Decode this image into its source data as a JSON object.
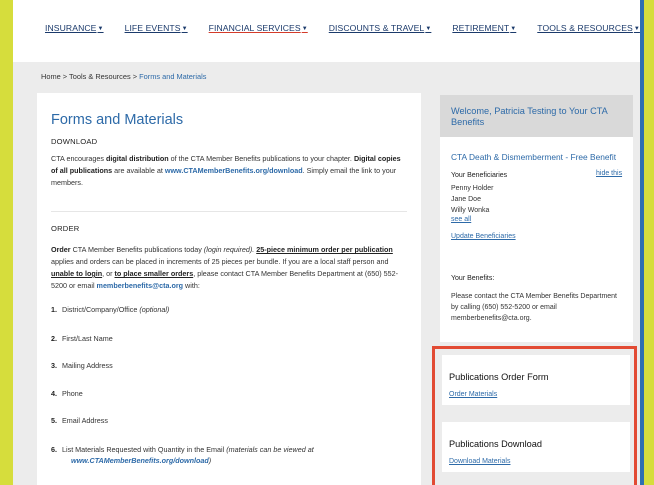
{
  "nav": [
    {
      "label": "INSURANCE",
      "red": false
    },
    {
      "label": "LIFE EVENTS",
      "red": false
    },
    {
      "label": "FINANCIAL SERVICES",
      "red": true
    },
    {
      "label": "DISCOUNTS & TRAVEL",
      "red": false
    },
    {
      "label": "RETIREMENT",
      "red": false
    },
    {
      "label": "TOOLS & RESOURCES",
      "red": false
    }
  ],
  "breadcrumb": {
    "home": "Home",
    "sep": ">",
    "section": "Tools & Resources",
    "current": "Forms and Materials"
  },
  "main": {
    "title": "Forms and Materials",
    "download_label": "DOWNLOAD",
    "download_p": {
      "t1": "CTA encourages ",
      "b1": "digital distribution",
      "t2": " of the CTA Member Benefits publications to your chapter. ",
      "b2": "Digital copies of all publications",
      "t3": " are available at ",
      "link": "www.CTAMemberBenefits.org/download",
      "t4": ". Simply email the link to your members."
    },
    "order_label": "ORDER",
    "order_p": {
      "b1": "Order",
      "t1": " CTA Member Benefits publications today ",
      "i1": "(login required).",
      "t2": " ",
      "u1": "25-piece minimum order per publication",
      "t3": " applies and orders can be placed in increments of 25 pieces per bundle. If you are a local staff person and ",
      "u2": "unable to login",
      "t4": ", or ",
      "u3": "to place smaller orders",
      "t5": ", please contact CTA Member Benefits Department at (650) 552-5200 or email ",
      "email": "memberbenefits@cta.org",
      "t6": " with:"
    },
    "list": [
      {
        "n": "1.",
        "text": "District/Company/Office ",
        "note": "(optional)"
      },
      {
        "n": "2.",
        "text": "First/Last Name",
        "note": ""
      },
      {
        "n": "3.",
        "text": "Mailing Address",
        "note": ""
      },
      {
        "n": "4.",
        "text": "Phone",
        "note": ""
      },
      {
        "n": "5.",
        "text": "Email Address",
        "note": ""
      },
      {
        "n": "6.",
        "text": "List Materials Requested with Quantity in the Email ",
        "note": "(materials can be viewed at ",
        "link": "www.CTAMemberBenefits.org/download",
        "close": ")"
      }
    ]
  },
  "sidebar": {
    "welcome": "Welcome, Patricia Testing to Your CTA Benefits",
    "benefit_title": "CTA Death & Dismemberment - Free Benefit",
    "beneficiaries_label": "Your Beneficiaries",
    "hide_link": "hide this",
    "beneficiaries": [
      "Penny Holder",
      "Jane Doe",
      "Willy Wonka"
    ],
    "see_all": "see all",
    "update": "Update Beneficiaries",
    "your_benefits_label": "Your Benefits:",
    "benefits_text": "Please contact the CTA Member Benefits Department by calling (650) 552-5200 or email memberbenefits@cta.org."
  },
  "cards": [
    {
      "title": "Publications Order Form",
      "link": "Order Materials"
    },
    {
      "title": "Publications Download",
      "link": "Download Materials"
    }
  ],
  "colors": {
    "highlight": "#e24b34",
    "link": "#2d6aa8",
    "page_bg": "#d6dd3c"
  }
}
